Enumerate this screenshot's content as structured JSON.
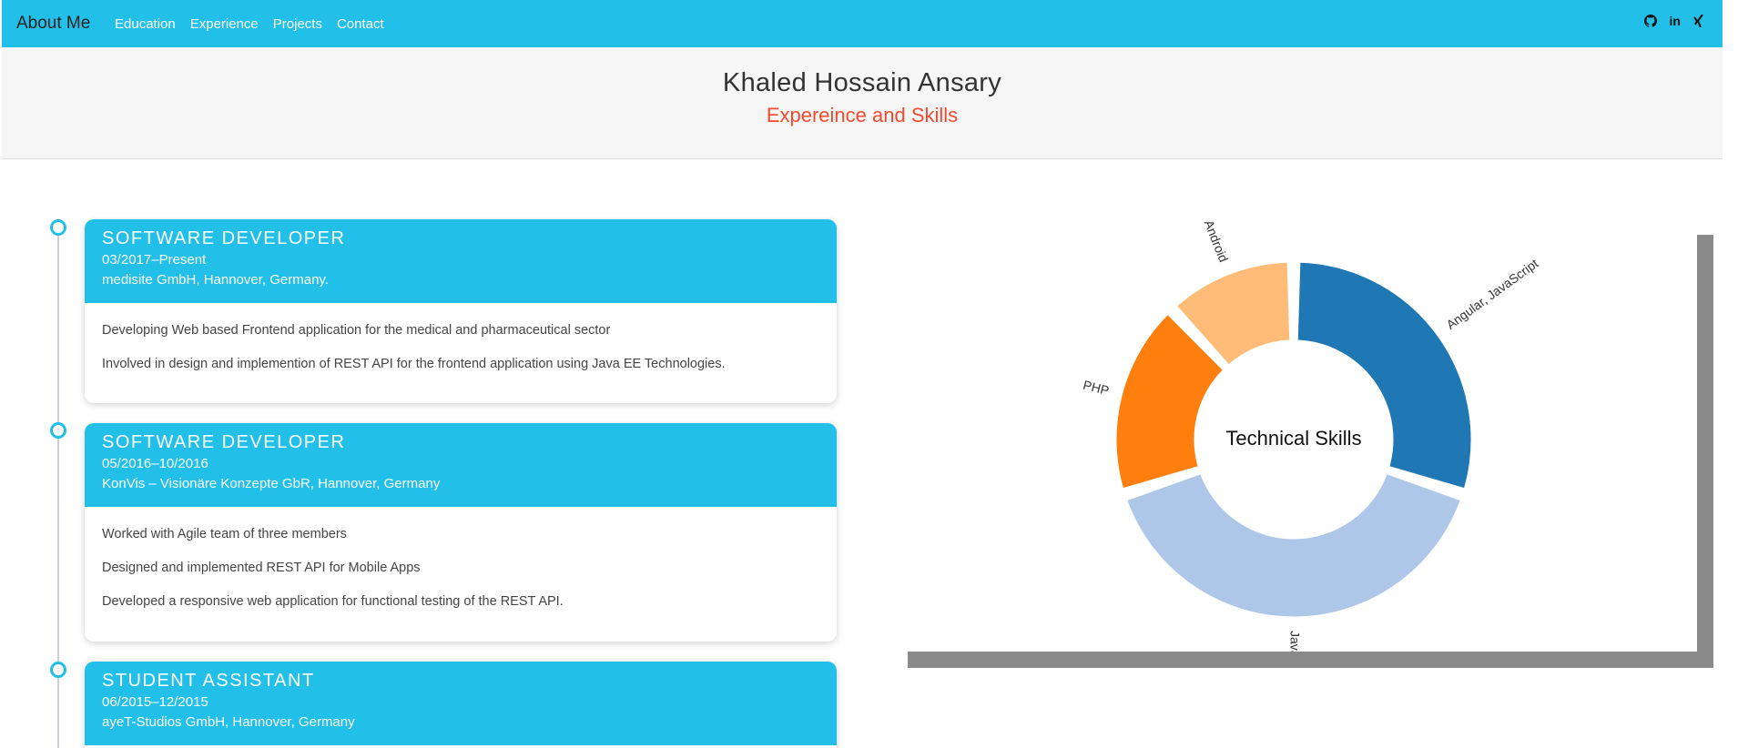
{
  "navbar": {
    "brand": "About Me",
    "links": [
      "Education",
      "Experience",
      "Projects",
      "Contact"
    ],
    "social": [
      "github-icon",
      "linkedin-icon",
      "xing-icon"
    ],
    "linkedin_label": "in",
    "color": "#22bfe8"
  },
  "header": {
    "name": "Khaled Hossain Ansary",
    "subtitle": "Expereince and Skills"
  },
  "experience": [
    {
      "title": "Software Developer",
      "period": "03/2017–Present",
      "company": "medisite GmbH, Hannover, Germany.",
      "items": [
        "Developing Web based Frontend application for the medical and pharmaceutical sector",
        "Involved in design and implemention of REST API for the frontend application using Java EE Technologies."
      ]
    },
    {
      "title": "Software Developer",
      "period": "05/2016–10/2016",
      "company": "KonVis – Visionäre Konzepte GbR, Hannover, Germany",
      "items": [
        "Worked with Agile team of three members",
        "Designed and implemented REST API for Mobile Apps",
        "Developed a responsive web application for functional testing of the REST API."
      ]
    },
    {
      "title": "Student Assistant",
      "period": "06/2015–12/2015",
      "company": "ayeT-Studios GmbH, Hannover, Germany",
      "items": []
    }
  ],
  "chart_data": {
    "type": "pie",
    "title": "Technical Skills",
    "categories": [
      "Angular, JavaScript",
      "Java",
      "PHP",
      "Android"
    ],
    "values": [
      30,
      40,
      18,
      12
    ],
    "colors": [
      "#1f77b4",
      "#aec7e8",
      "#ff7f0e",
      "#ffbb78"
    ]
  }
}
